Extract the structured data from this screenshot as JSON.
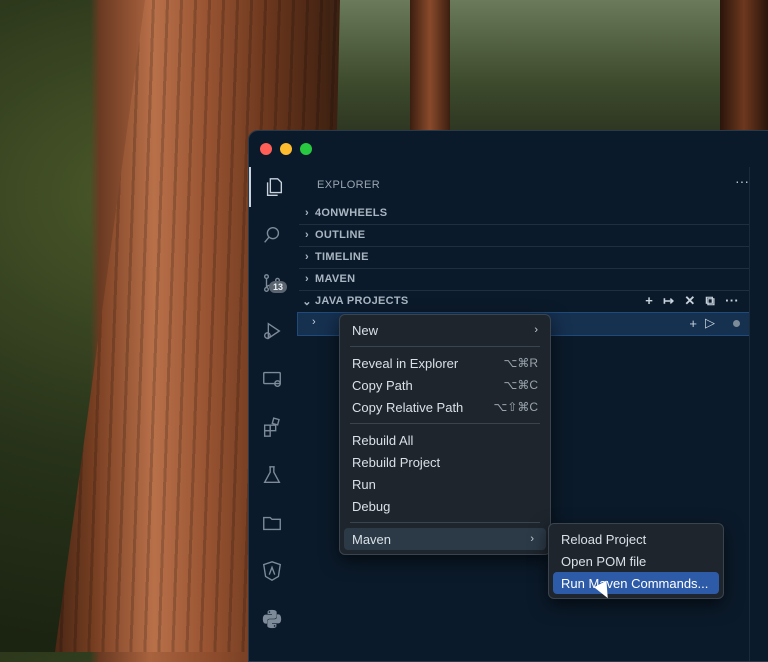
{
  "sidebar": {
    "title": "EXPLORER",
    "more": "···",
    "sections": [
      {
        "label": "4ONWHEELS"
      },
      {
        "label": "OUTLINE"
      },
      {
        "label": "TIMELINE"
      },
      {
        "label": "MAVEN"
      },
      {
        "label": "JAVA PROJECTS"
      }
    ]
  },
  "activity": {
    "scm_badge": "13"
  },
  "context_menu": {
    "new": "New",
    "reveal": "Reveal in Explorer",
    "reveal_sc": "⌥⌘R",
    "copy_path": "Copy Path",
    "copy_path_sc": "⌥⌘C",
    "copy_rel": "Copy Relative Path",
    "copy_rel_sc": "⌥⇧⌘C",
    "rebuild_all": "Rebuild All",
    "rebuild_project": "Rebuild Project",
    "run": "Run",
    "debug": "Debug",
    "maven": "Maven"
  },
  "submenu": {
    "reload": "Reload Project",
    "open_pom": "Open POM file",
    "run_cmds": "Run Maven Commands..."
  },
  "colors": {
    "selection": "#2d5ba8",
    "window_bg": "#0b1a2a"
  }
}
